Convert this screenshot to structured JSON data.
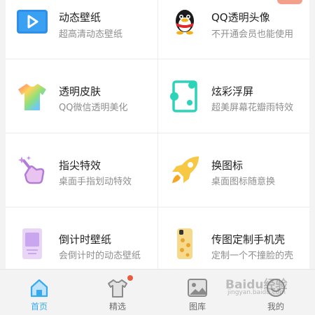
{
  "features": [
    {
      "title": "动态壁纸",
      "subtitle": "超高清动态壁纸",
      "icon": "play-video-icon"
    },
    {
      "title": "QQ透明头像",
      "subtitle": "不开通会员也能使用",
      "icon": "qq-penguin-icon"
    },
    {
      "title": "透明皮肤",
      "subtitle": "QQ微信透明美化",
      "icon": "rainbow-shirt-icon"
    },
    {
      "title": "炫彩浮屏",
      "subtitle": "超美屏幕花瓣雨特效",
      "icon": "floating-screen-icon"
    },
    {
      "title": "指尖特效",
      "subtitle": "桌面手指划动特效",
      "icon": "finger-sparkle-icon"
    },
    {
      "title": "换图标",
      "subtitle": "桌面图标随意换",
      "icon": "rocket-icon"
    },
    {
      "title": "倒计时壁纸",
      "subtitle": "会倒计时的动态壁纸",
      "icon": "countdown-phone-icon"
    },
    {
      "title": "传图定制手机壳",
      "subtitle": "定制一个不撞脸的壳",
      "icon": "phone-case-icon"
    }
  ],
  "tabs": [
    {
      "label": "首页",
      "icon": "home-icon",
      "active": true
    },
    {
      "label": "精选",
      "icon": "tshirt-icon",
      "active": false,
      "badge": true
    },
    {
      "label": "图库",
      "icon": "gallery-icon",
      "active": false
    },
    {
      "label": "我的",
      "icon": "profile-icon",
      "active": false
    }
  ],
  "watermark": {
    "line1": "Baidu经验",
    "line2": "jingyan.baidu.com"
  },
  "colors": {
    "accent": "#39a9ee",
    "badge": "#e85b3d",
    "background": "#f3f3f3"
  }
}
